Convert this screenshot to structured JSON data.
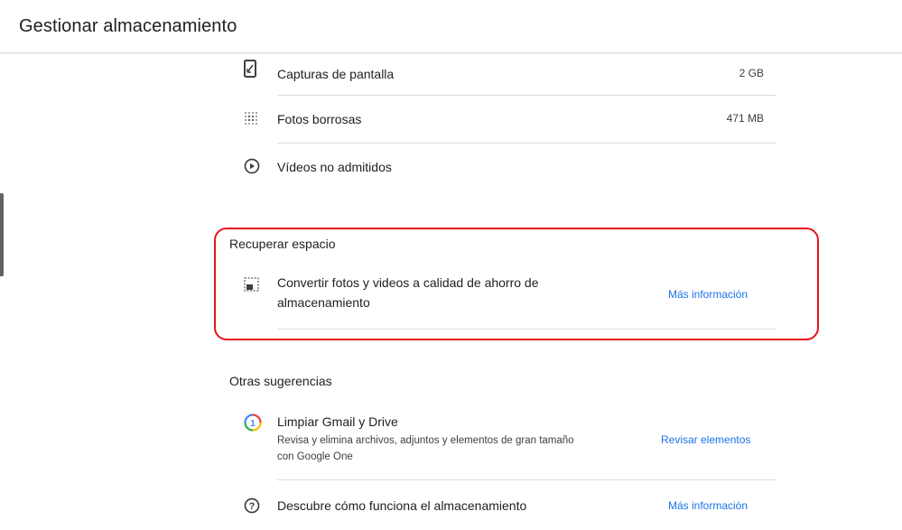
{
  "header": {
    "title": "Gestionar almacenamiento"
  },
  "categories": [
    {
      "icon": "phone-screenshot-icon",
      "label": "Capturas de pantalla",
      "size": "2 GB"
    },
    {
      "icon": "blur-grid-icon",
      "label": "Fotos borrosas",
      "size": "471 MB"
    },
    {
      "icon": "play-circle-icon",
      "label": "Vídeos no admitidos",
      "size": ""
    }
  ],
  "recover": {
    "title": "Recuperar espacio",
    "item": {
      "icon": "storage-saver-icon",
      "label": "Convertir fotos y videos a calidad de ahorro de almacenamiento",
      "label_line1": "Convertir fotos y videos a calidad de ahorro de",
      "label_line2": "almacenamiento",
      "link": "Más información"
    }
  },
  "suggestions": {
    "title": "Otras sugerencias",
    "items": [
      {
        "icon": "google-one-icon",
        "label": "Limpiar Gmail y Drive",
        "description_line1": "Revisa y elimina archivos, adjuntos y elementos de gran tamaño",
        "description_line2": "con Google One",
        "link": "Revisar elementos"
      },
      {
        "icon": "help-circle-icon",
        "label": "Descubre cómo funciona el almacenamiento",
        "link": "Más información"
      }
    ]
  },
  "colors": {
    "accent_link": "#1a73e8",
    "highlight_border": "#e8131c",
    "divider": "#dadce0",
    "text": "#202124"
  }
}
